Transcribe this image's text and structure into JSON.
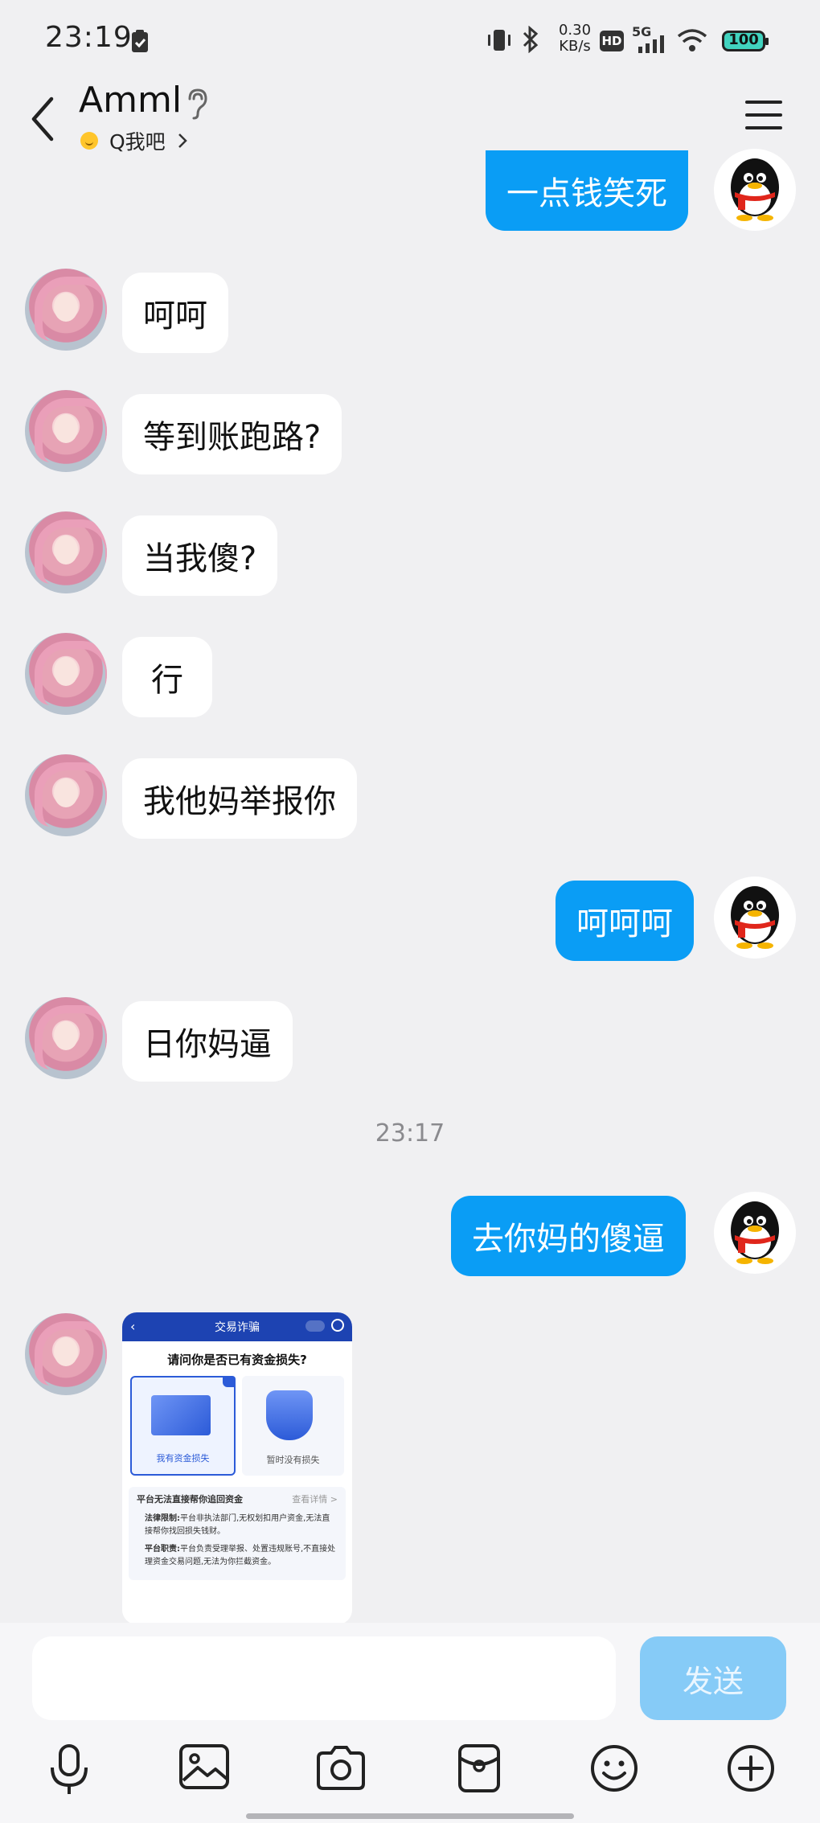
{
  "status_bar": {
    "time": "23:19",
    "net_speed_value": "0.30",
    "net_speed_unit": "KB/s",
    "hd_badge": "HD",
    "network_type": "5G",
    "battery": "100",
    "icons": [
      "clipboard-check-icon",
      "vibrate-icon",
      "bluetooth-icon",
      "hd-icon",
      "signal-icon",
      "wifi-icon",
      "battery-icon"
    ]
  },
  "header": {
    "contact_name": "Amml",
    "subtitle": "Q我吧",
    "icons": [
      "back-icon",
      "hearing-icon",
      "smile-icon",
      "chevron-right-icon",
      "menu-icon"
    ]
  },
  "messages": [
    {
      "side": "out",
      "text": "一点钱笑死"
    },
    {
      "side": "in",
      "text": "呵呵"
    },
    {
      "side": "in",
      "text": "等到账跑路?"
    },
    {
      "side": "in",
      "text": "当我傻?"
    },
    {
      "side": "in",
      "text": "行"
    },
    {
      "side": "in",
      "text": "我他妈举报你"
    },
    {
      "side": "out",
      "text": "呵呵呵"
    },
    {
      "side": "in",
      "text": "日你妈逼"
    },
    {
      "side": "out",
      "text": "去你妈的傻逼"
    }
  ],
  "timestamp": "23:17",
  "image_message": {
    "title": "交易诈骗",
    "question": "请问你是否已有资金损失?",
    "option_1": "我有资金损失",
    "option_2": "暂时没有损失",
    "info_heading": "平台无法直接帮你追回资金",
    "info_link": "查看详情 >",
    "point_1_label": "法律限制:",
    "point_1_text": "平台非执法部门,无权划扣用户资金,无法直接帮你找回损失钱财。",
    "point_2_label": "平台职责:",
    "point_2_text": "平台负责受理举报、处置违规账号,不直接处理资金交易问题,无法为你拦截资金。"
  },
  "input_bar": {
    "text_value": "",
    "send_label": "发送",
    "tools": [
      "microphone-icon",
      "image-icon",
      "camera-icon",
      "red-packet-icon",
      "emoji-icon",
      "plus-icon"
    ]
  },
  "colors": {
    "background": "#f0f0f2",
    "outgoing_bubble": "#0a9df5",
    "incoming_bubble": "#ffffff",
    "send_button": "#86cbf7",
    "battery": "#41d3bf"
  }
}
